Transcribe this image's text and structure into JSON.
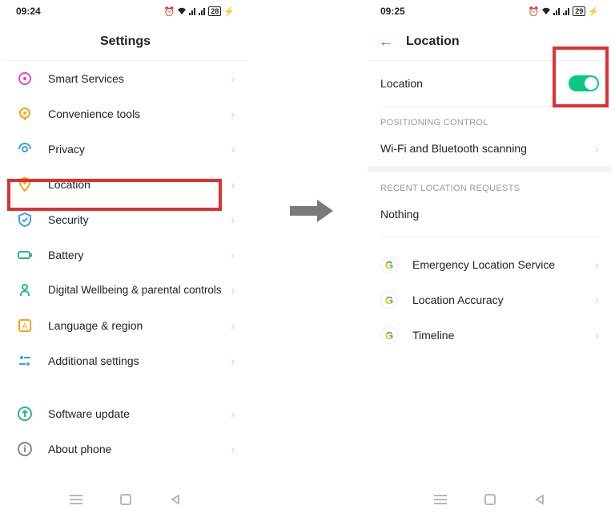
{
  "left": {
    "status": {
      "time": "09:24",
      "battery": "28"
    },
    "title": "Settings",
    "items": [
      {
        "label": "Smart Services"
      },
      {
        "label": "Convenience tools"
      },
      {
        "label": "Privacy"
      },
      {
        "label": "Location"
      },
      {
        "label": "Security"
      },
      {
        "label": "Battery"
      },
      {
        "label": "Digital Wellbeing & parental controls"
      },
      {
        "label": "Language & region"
      },
      {
        "label": "Additional settings"
      }
    ],
    "footer": [
      {
        "label": "Software update"
      },
      {
        "label": "About phone"
      }
    ]
  },
  "right": {
    "status": {
      "time": "09:25",
      "battery": "29"
    },
    "title": "Location",
    "toggle": {
      "label": "Location",
      "on": true
    },
    "section1": {
      "header": "Positioning Control",
      "item": "Wi-Fi and Bluetooth scanning"
    },
    "section2": {
      "header": "Recent Location Requests",
      "item": "Nothing"
    },
    "google": [
      {
        "label": "Emergency Location Service"
      },
      {
        "label": "Location Accuracy"
      },
      {
        "label": "Timeline"
      }
    ]
  },
  "colors": {
    "accent": "#07c97f",
    "highlight": "#e03030"
  }
}
